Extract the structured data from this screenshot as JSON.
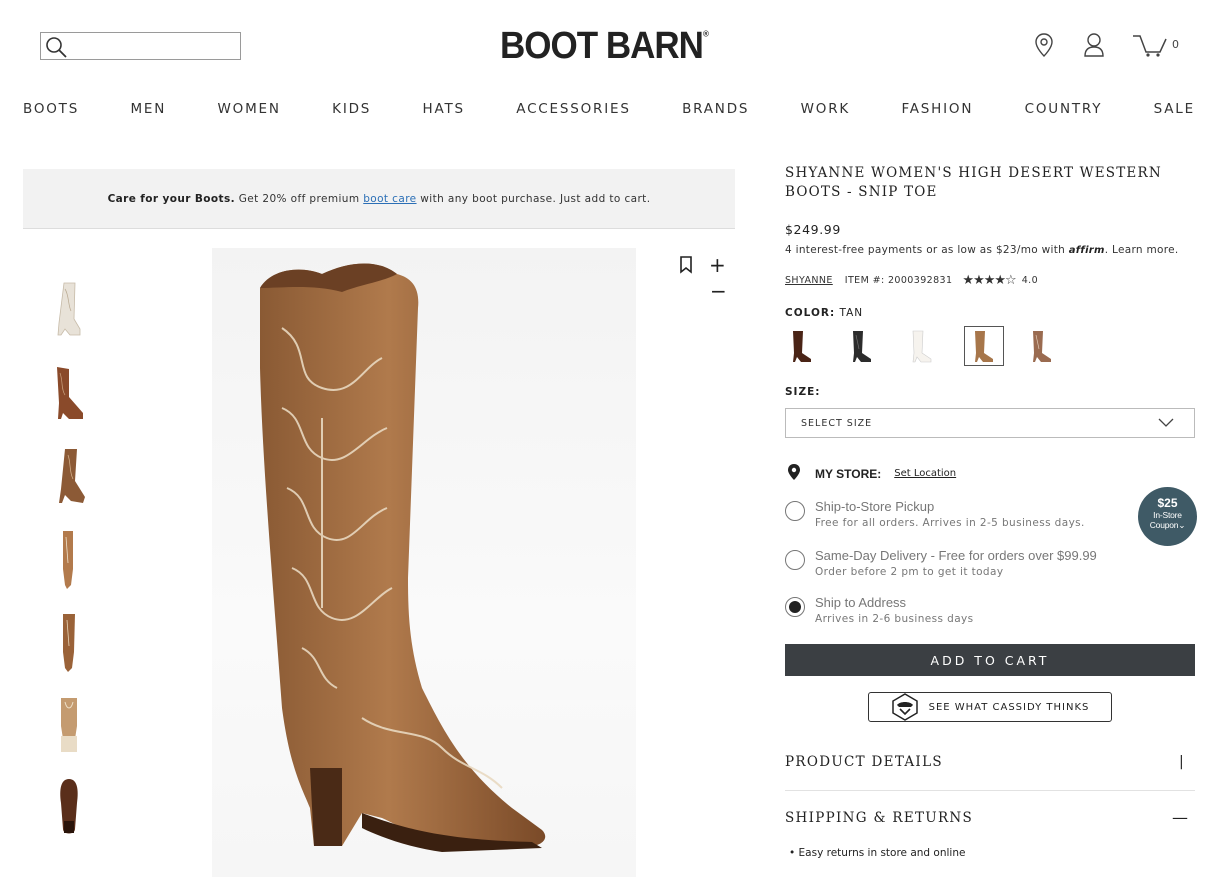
{
  "header": {
    "logo": "BOOT BARN",
    "logo_mark": "®",
    "search_placeholder": "",
    "cart_count": "0"
  },
  "nav": {
    "items": [
      "BOOTS",
      "MEN",
      "WOMEN",
      "KIDS",
      "HATS",
      "ACCESSORIES",
      "BRANDS",
      "WORK",
      "FASHION",
      "COUNTRY",
      "SALE"
    ]
  },
  "promo": {
    "bold": "Care for your Boots.",
    "text_before": "Get 20% off premium",
    "link": "boot care",
    "text_after": "with any boot purchase. Just add to cart."
  },
  "product": {
    "title": "SHYANNE WOMEN'S HIGH DESERT WESTERN BOOTS - SNIP TOE",
    "price": "$249.99",
    "affirm_prefix": "4 interest-free payments or as low as $23/mo with",
    "affirm_logo": "affirm",
    "affirm_suffix": ". Learn more.",
    "brand": "SHYANNE",
    "item_number": "ITEM #: 2000392831",
    "stars": "★★★★☆",
    "rating": "4.0",
    "color_label": "COLOR:",
    "color_value": "TAN",
    "size_label": "SIZE:",
    "size_placeholder": "SELECT SIZE"
  },
  "store": {
    "label": "MY STORE:",
    "set_location": "Set Location"
  },
  "shipping_options": [
    {
      "title": "Ship-to-Store Pickup",
      "sub": "Free for all orders. Arrives in 2-5 business days.",
      "selected": false
    },
    {
      "title": "Same-Day Delivery - Free for orders over $99.99",
      "sub": "Order before 2 pm to get it today",
      "selected": false
    },
    {
      "title": "Ship to Address",
      "sub": "Arrives in 2-6 business days",
      "selected": true
    }
  ],
  "coupon": {
    "amount": "$25",
    "line1": "In-Store",
    "line2": "Coupon"
  },
  "actions": {
    "add_to_cart": "ADD TO CART",
    "cassidy": "SEE WHAT CASSIDY THINKS"
  },
  "accordion": {
    "details": "PRODUCT DETAILS",
    "shipping": "SHIPPING & RETURNS",
    "bullet": "• Easy returns in store and online"
  },
  "colors": {
    "button_dark": "#3b3f43",
    "coupon_bg": "#3f5a66",
    "link_blue": "#2b6fb6",
    "boot_tan": "#a7764a"
  }
}
